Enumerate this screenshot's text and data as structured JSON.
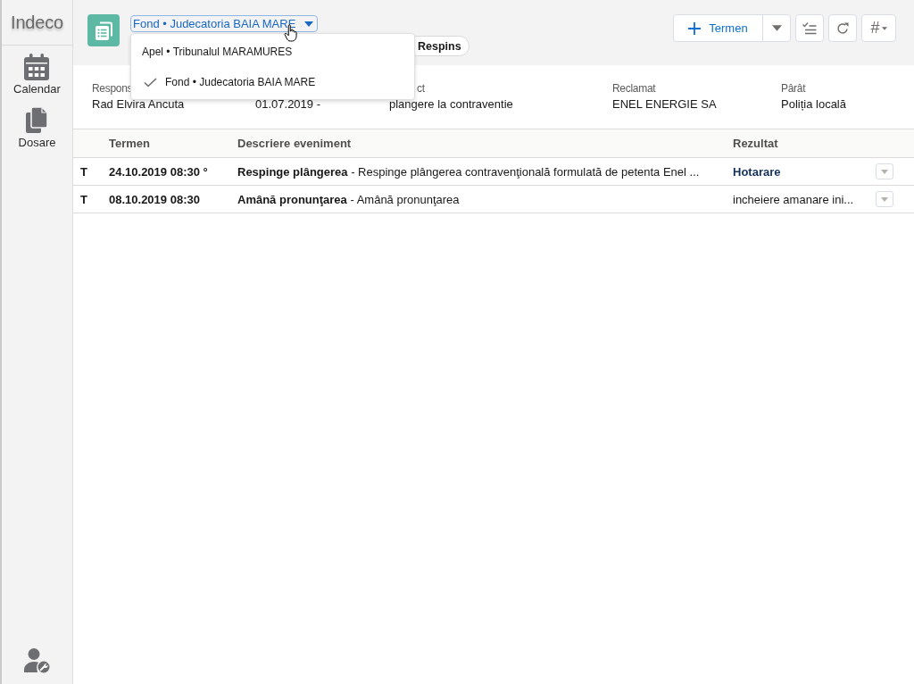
{
  "sidebar": {
    "logo": "Indeco",
    "items": [
      {
        "label": "Calendar",
        "kind": "calendar",
        "selected": false
      },
      {
        "label": "Dosare",
        "kind": "documents",
        "selected": false
      }
    ]
  },
  "header": {
    "case_selector": {
      "value": "Fond • Judecatoria BAIA MARE",
      "expanded": true
    },
    "menu": [
      {
        "label": "Apel • Tribunalul MARAMURES",
        "selected": false
      },
      {
        "label": "Fond • Judecatoria BAIA MARE",
        "selected": true
      }
    ],
    "status_pill": "Respins",
    "toolbar": {
      "add_label": "Termen",
      "hash_label": "#"
    }
  },
  "details": [
    {
      "label": "Respons",
      "value": "Rad Elvira Ancuta"
    },
    {
      "value": "01.07.2019 -"
    },
    {
      "label": "ct",
      "value": "plangere la contraventie"
    },
    {
      "label": "Reclamat",
      "value": "ENEL ENERGIE SA"
    },
    {
      "label": "Pârât",
      "value": "Poliția locală"
    }
  ],
  "table": {
    "columns": [
      "Termen",
      "Descriere eveniment",
      "Rezultat"
    ],
    "rows": [
      {
        "type": "T",
        "date": "24.10.2019 08:30 °",
        "description": "**Respinge plângerea** - Respinge plângerea contravenţională formulată de petenta Enel ...",
        "result": {
          "text": "Hotarare",
          "kind": "link"
        }
      },
      {
        "type": "T",
        "date": "08.10.2019 08:30",
        "description": "**Amână pronunţarea** - Amână pronunţarea",
        "result": {
          "text": "incheiere amanare ini...",
          "kind": "text"
        }
      }
    ]
  }
}
